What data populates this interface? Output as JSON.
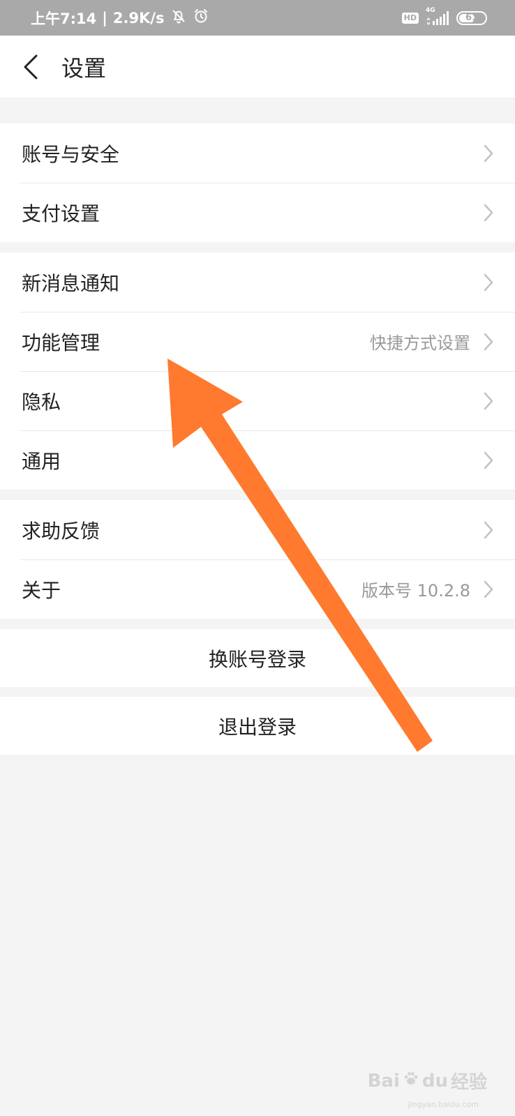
{
  "status_bar": {
    "time": "上午7:14",
    "separator": "|",
    "speed": "2.9K/s",
    "icons": [
      "bell-muted-icon",
      "alarm-icon"
    ],
    "hd_label": "HD",
    "network_label": "4G",
    "battery_level": "61",
    "battery_fraction": 0.61
  },
  "nav": {
    "back_icon": "chevron-left-icon",
    "title": "设置"
  },
  "groups": [
    {
      "rows": [
        {
          "label": "账号与安全",
          "value": ""
        },
        {
          "label": "支付设置",
          "value": ""
        }
      ]
    },
    {
      "rows": [
        {
          "label": "新消息通知",
          "value": ""
        },
        {
          "label": "功能管理",
          "value": "快捷方式设置"
        },
        {
          "label": "隐私",
          "value": ""
        },
        {
          "label": "通用",
          "value": ""
        }
      ]
    },
    {
      "rows": [
        {
          "label": "求助反馈",
          "value": ""
        },
        {
          "label": "关于",
          "value": "版本号 10.2.8"
        }
      ]
    }
  ],
  "actions": {
    "switch_account": "换账号登录",
    "logout": "退出登录"
  },
  "watermark": {
    "brand": "Bai",
    "brand_tail": "du",
    "product": "经验",
    "url": "jingyan.baidu.com"
  },
  "colors": {
    "status_bar_bg": "#a9a9a9",
    "page_bg": "#f4f4f4",
    "annotation_arrow": "#ff7a2e",
    "chevron": "#c2c2c2",
    "secondary_text": "#999999"
  }
}
